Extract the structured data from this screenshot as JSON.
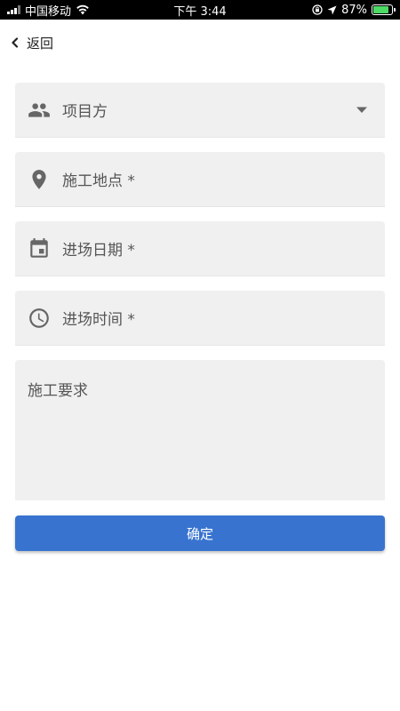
{
  "status_bar": {
    "carrier": "中国移动",
    "time": "下午 3:44",
    "battery_percent": "87%"
  },
  "nav": {
    "back_label": "返回"
  },
  "form": {
    "project_party": {
      "label": "项目方",
      "icon": "people-icon"
    },
    "location": {
      "label": "施工地点 *",
      "icon": "location-pin-icon"
    },
    "entry_date": {
      "label": "进场日期 *",
      "icon": "calendar-icon"
    },
    "entry_time": {
      "label": "进场时间 *",
      "icon": "clock-icon"
    },
    "requirements": {
      "placeholder": "施工要求"
    }
  },
  "confirm_label": "确定",
  "colors": {
    "primary": "#3874cf",
    "field_bg": "#f0f0f0",
    "icon": "#666666"
  }
}
